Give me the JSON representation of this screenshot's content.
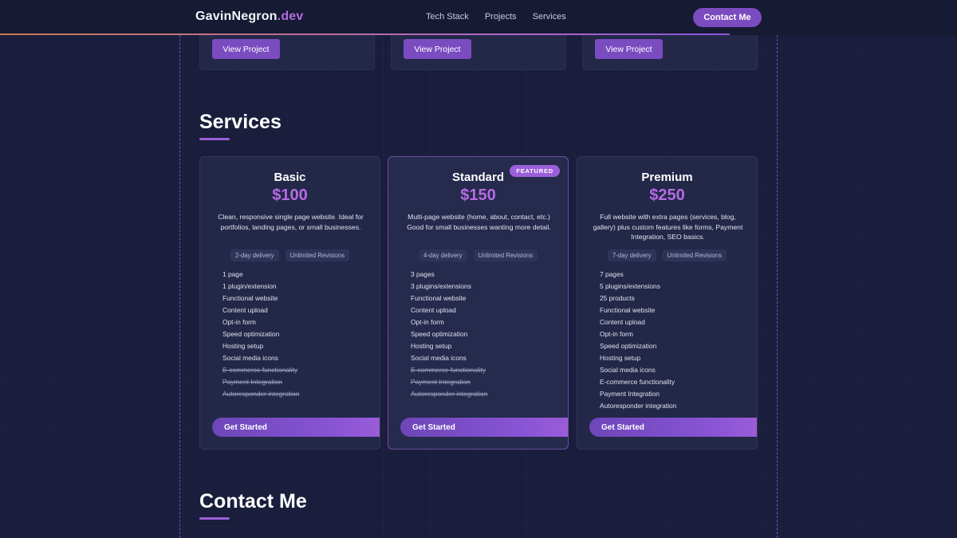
{
  "nav": {
    "brand_main": "GavinNegron",
    "brand_tld": ".dev",
    "links": [
      "Tech Stack",
      "Projects",
      "Services"
    ],
    "contact_label": "Contact Me"
  },
  "projects": {
    "view_label": "View Project"
  },
  "services": {
    "title": "Services",
    "plans": [
      {
        "name": "Basic",
        "price": "$100",
        "description": "Clean, responsive single page website. Ideal for portfolios, landing pages, or small businesses.",
        "delivery": "2-day delivery",
        "revisions": "Unlimited Revisions",
        "features": [
          {
            "text": "1 page",
            "included": true
          },
          {
            "text": "1 plugin/extension",
            "included": true
          },
          {
            "text": "Functional website",
            "included": true
          },
          {
            "text": "Content upload",
            "included": true
          },
          {
            "text": "Opt-in form",
            "included": true
          },
          {
            "text": "Speed optimization",
            "included": true
          },
          {
            "text": "Hosting setup",
            "included": true
          },
          {
            "text": "Social media icons",
            "included": true
          },
          {
            "text": "E-commerce functionality",
            "included": false
          },
          {
            "text": "Payment Integration",
            "included": false
          },
          {
            "text": "Autoresponder integration",
            "included": false
          }
        ],
        "cta": "Get Started"
      },
      {
        "name": "Standard",
        "price": "$150",
        "badge": "FEATURED",
        "description": "Multi-page website (home, about, contact, etc.) Good for small businesses wanting more detail.",
        "delivery": "4-day delivery",
        "revisions": "Unlimited Revisions",
        "features": [
          {
            "text": "3 pages",
            "included": true
          },
          {
            "text": "3 plugins/extensions",
            "included": true
          },
          {
            "text": "Functional website",
            "included": true
          },
          {
            "text": "Content upload",
            "included": true
          },
          {
            "text": "Opt-in form",
            "included": true
          },
          {
            "text": "Speed optimization",
            "included": true
          },
          {
            "text": "Hosting setup",
            "included": true
          },
          {
            "text": "Social media icons",
            "included": true
          },
          {
            "text": "E-commerce functionality",
            "included": false
          },
          {
            "text": "Payment Integration",
            "included": false
          },
          {
            "text": "Autoresponder integration",
            "included": false
          }
        ],
        "cta": "Get Started"
      },
      {
        "name": "Premium",
        "price": "$250",
        "description": "Full website with extra pages (services, blog, gallery) plus custom features like forms, Payment Integration, SEO basics.",
        "delivery": "7-day delivery",
        "revisions": "Unlimited Revisions",
        "features": [
          {
            "text": "7 pages",
            "included": true
          },
          {
            "text": "5 plugins/extensions",
            "included": true
          },
          {
            "text": "25 products",
            "included": true
          },
          {
            "text": "Functional website",
            "included": true
          },
          {
            "text": "Content upload",
            "included": true
          },
          {
            "text": "Opt-in form",
            "included": true
          },
          {
            "text": "Speed optimization",
            "included": true
          },
          {
            "text": "Hosting setup",
            "included": true
          },
          {
            "text": "Social media icons",
            "included": true
          },
          {
            "text": "E-commerce functionality",
            "included": true
          },
          {
            "text": "Payment Integration",
            "included": true
          },
          {
            "text": "Autoresponder integration",
            "included": true
          }
        ],
        "cta": "Get Started"
      }
    ]
  },
  "contact": {
    "title": "Contact Me"
  },
  "colors": {
    "background": "#1a1e3c",
    "card": "#232849",
    "accent": "#b66be2",
    "button": "#7b4cc0"
  }
}
